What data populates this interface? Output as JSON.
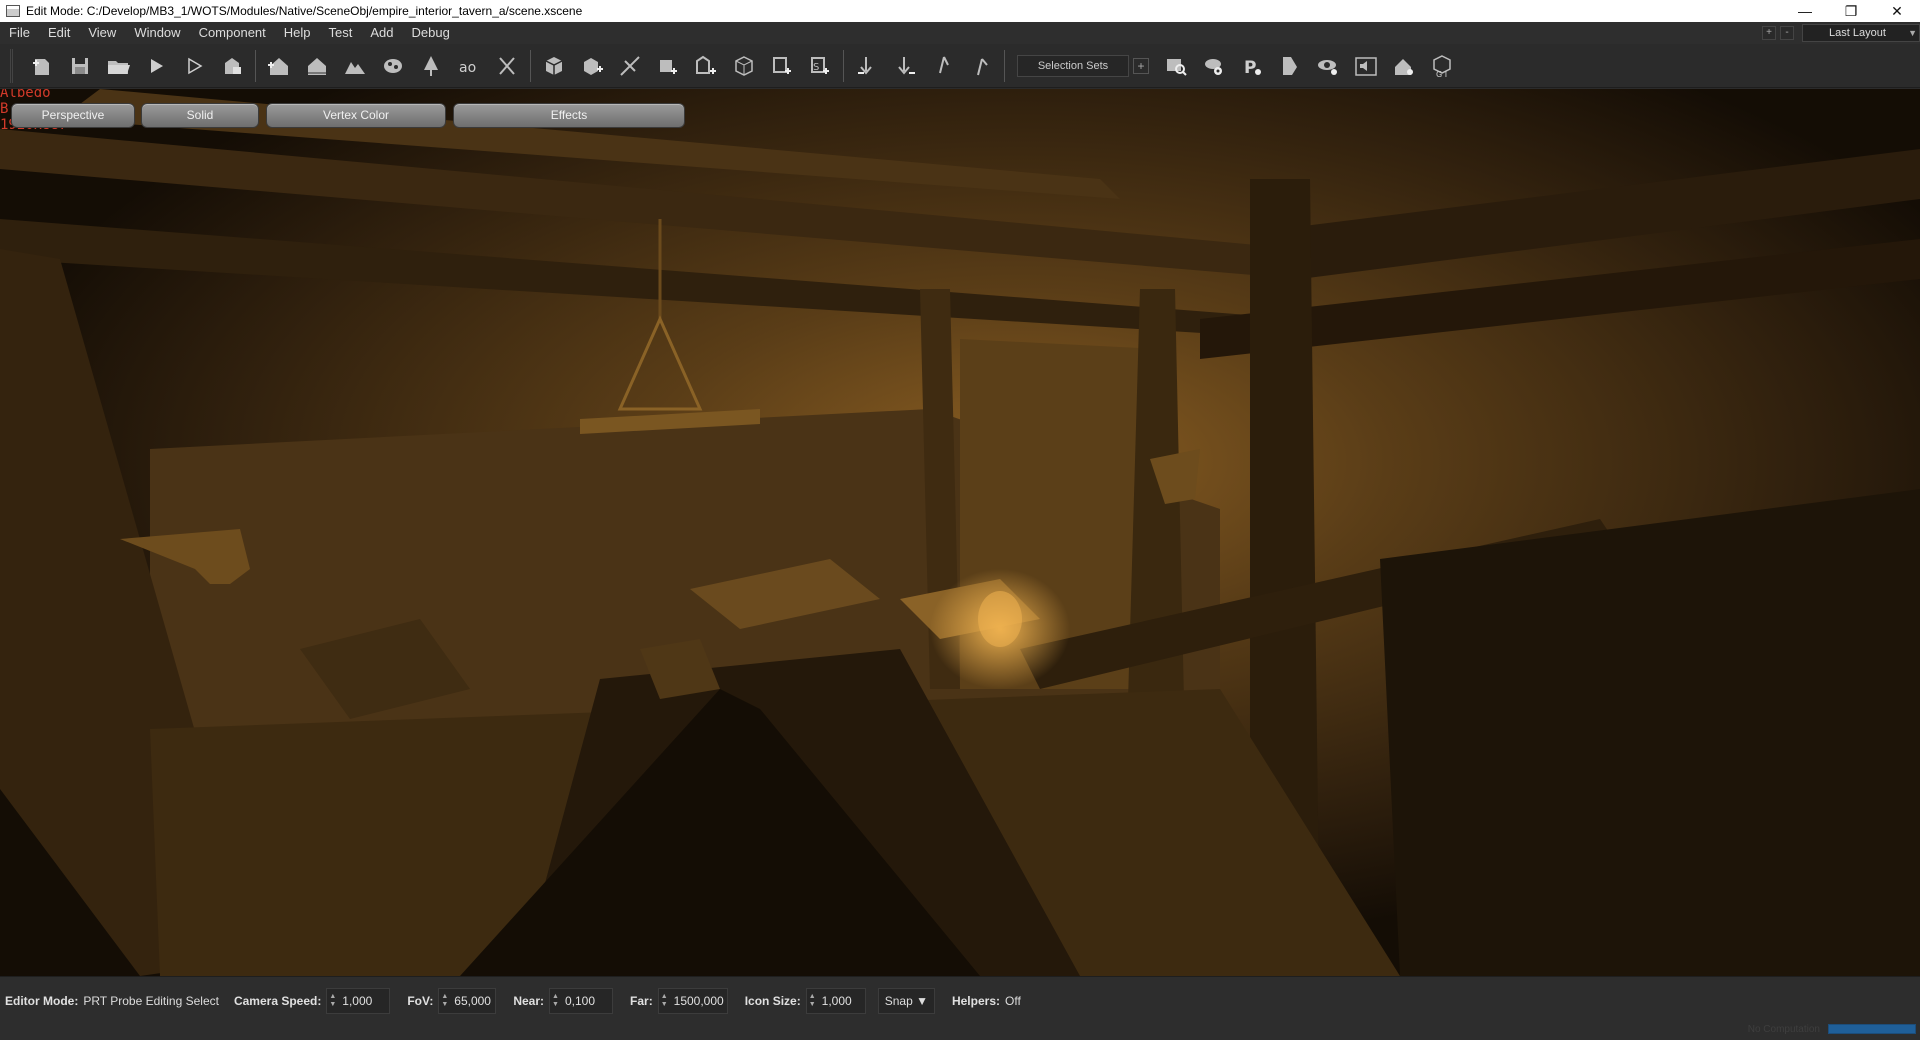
{
  "window": {
    "title": "Edit Mode: C:/Develop/MB3_1/WOTS/Modules/Native/SceneObj/empire_interior_tavern_a/scene.xscene",
    "minimize_glyph": "—",
    "restore_glyph": "❐",
    "close_glyph": "✕"
  },
  "menu": {
    "items": [
      "File",
      "Edit",
      "View",
      "Window",
      "Component",
      "Help",
      "Test",
      "Add",
      "Debug"
    ],
    "add_glyph": "+",
    "remove_glyph": "-",
    "layout_label": "Last Layout"
  },
  "toolbar": {
    "selection_sets_label": "Selection Sets",
    "add_set_glyph": "+",
    "icons": [
      "new-scene-icon",
      "save-icon",
      "open-folder-icon",
      "play-icon",
      "play-outline-icon",
      "lock-scene-icon",
      "house-icon",
      "house-alt-icon",
      "terrain-icon",
      "paint-icon",
      "tree-icon",
      "text-ao-icon",
      "split-icon",
      "cube-icon",
      "cube-add-icon",
      "slice-icon",
      "mesh-add-icon",
      "mesh-add-alt-icon",
      "mesh-frame-icon",
      "mesh-stack-icon",
      "mesh-point-icon",
      "anchor-add-icon",
      "anchor-remove-icon",
      "anchor-up-icon",
      "anchor-down-icon",
      "search-scene-icon",
      "cloud-settings-icon",
      "brush-icon",
      "chip-icon",
      "eye-settings-icon",
      "sound-icon",
      "cloud-house-icon",
      "gi-icon"
    ]
  },
  "viewport": {
    "overlay_lines": [
      "Albedo",
      "B",
      "1920x887"
    ],
    "buttons": {
      "perspective": "Perspective",
      "solid": "Solid",
      "vertex_color": "Vertex Color",
      "effects": "Effects"
    }
  },
  "status": {
    "editor_mode_label": "Editor Mode:",
    "editor_mode_value": "PRT Probe Editing Select",
    "camera_speed_label": "Camera Speed:",
    "camera_speed_value": "1,000",
    "fov_label": "FoV:",
    "fov_value": "65,000",
    "near_label": "Near:",
    "near_value": "0,100",
    "far_label": "Far:",
    "far_value": "1500,000",
    "icon_size_label": "Icon Size:",
    "icon_size_value": "1,000",
    "snap_label": "Snap ▼",
    "helpers_label": "Helpers:",
    "helpers_value": "Off",
    "progress_label": "No Computation",
    "progress_fraction": 1.0
  }
}
